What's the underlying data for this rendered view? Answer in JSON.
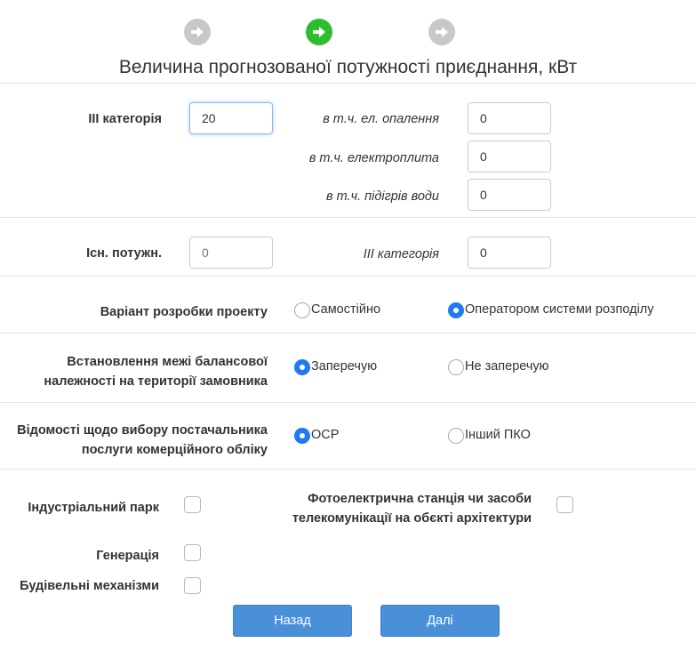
{
  "steps": [
    {
      "name": "step-1",
      "state": "inactive"
    },
    {
      "name": "step-2",
      "state": "active"
    },
    {
      "name": "step-3",
      "state": "inactive"
    }
  ],
  "title": "Величина прогнозованої потужності приєднання, кВт",
  "power": {
    "category3_label": "ІІІ категорія",
    "category3_value": "20",
    "heating_label": "в т.ч. ел. опалення",
    "heating_value": "0",
    "stove_label": "в т.ч. електроплита",
    "stove_value": "0",
    "water_label": "в т.ч. підігрів води",
    "water_value": "0"
  },
  "existing": {
    "label": "Існ. потужн.",
    "placeholder": "0",
    "category_label": "ІІІ категорія",
    "category_value": "0"
  },
  "project_variant": {
    "label": "Варіант розробки проекту",
    "options": [
      "Самостійно",
      "Оператором системи розподілу"
    ],
    "selected": "Оператором системи розподілу"
  },
  "balance_boundary": {
    "label_line1": "Встановлення межі балансової",
    "label_line2": "належності на території замовника",
    "options": [
      "Заперечую",
      "Не заперечую"
    ],
    "selected": "Заперечую"
  },
  "supplier": {
    "label_line1": "Відомості щодо вибору постачальника",
    "label_line2": "послуги комерційного обліку",
    "options": [
      "ОСР",
      "Інший ПКО"
    ],
    "selected": "ОСР"
  },
  "flags": {
    "industrial_park": "Індустріальний парк",
    "solar_line1": "Фотоелектрична станція чи засоби",
    "solar_line2": "телекомунікації на обєкті архітектури",
    "generation": "Генерація",
    "construction": "Будівельні механізми"
  },
  "buttons": {
    "back": "Назад",
    "next": "Далі"
  },
  "colors": {
    "accent": "#4a90d9",
    "active_step": "#2fbd2f",
    "inactive_step": "#c8c8c8",
    "radio_checked": "#1e7cf0"
  }
}
